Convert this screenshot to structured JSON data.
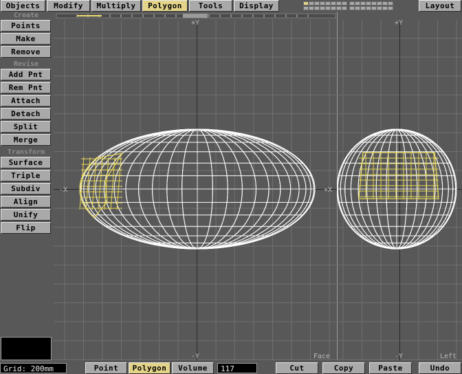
{
  "menu": {
    "objects": "Objects",
    "modify": "Modify",
    "multiply": "Multiply",
    "polygon": "Polygon",
    "tools": "Tools",
    "display": "Display",
    "layout": "Layout"
  },
  "sidebar": {
    "create_header": "Create",
    "create": [
      "Points",
      "Make",
      "Remove"
    ],
    "revise_header": "Revise",
    "revise": [
      "Add Pnt",
      "Rem Pnt",
      "Attach",
      "Detach",
      "Split",
      "Merge"
    ],
    "transform_header": "Transform",
    "transform": [
      "Surface",
      "Triple",
      "Subdiv",
      "Align",
      "Unify",
      "Flip"
    ]
  },
  "viewports": {
    "top": {
      "axis_top": "+Y",
      "axis_bottom": "-Y",
      "axis_left": "-X",
      "axis_right": "+X",
      "name": "Face"
    },
    "left": {
      "axis_top": "+Y",
      "axis_bottom": "-Y",
      "name": "Left"
    }
  },
  "bottom": {
    "grid_label": "Grid:",
    "grid_value": "200mm",
    "modes": [
      "Point",
      "Polygon",
      "Volume"
    ],
    "count": "117",
    "cut": "Cut",
    "copy": "Copy",
    "paste": "Paste",
    "undo": "Undo"
  },
  "colors": {
    "background": "#585858",
    "button": "#a9a9a9",
    "active": "#e4d48a",
    "grid": "#6f6f6f",
    "mesh": "#ffffff",
    "selection": "#e8d85a"
  },
  "icons": {
    "layer_indicator": "layer-icon",
    "slider": "slider-icon"
  }
}
